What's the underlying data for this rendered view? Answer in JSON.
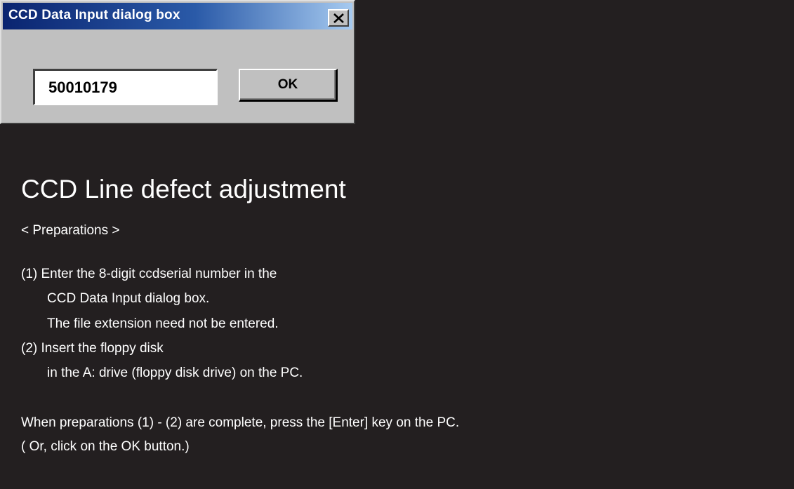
{
  "dialog": {
    "title": "CCD Data Input dialog box",
    "close_icon": "close-icon",
    "serial_value": "50010179",
    "ok_label": "OK"
  },
  "instructions": {
    "heading": "CCD Line defect adjustment",
    "preparations_label": "< Preparations >",
    "step1_line1": "(1) Enter the 8-digit ccdserial number in the",
    "step1_line2": "CCD Data Input dialog box.",
    "step1_line3": "The file extension need not be entered.",
    "step2_line1": "(2) Insert the floppy disk",
    "step2_line2": "in the A: drive (floppy disk drive) on the PC.",
    "completion_line1": "When preparations (1) - (2) are complete, press the [Enter] key on the PC.",
    "completion_line2": "( Or, click on the OK button.)"
  },
  "colors": {
    "background": "#231f20",
    "dialog_face": "#c0c0c0",
    "titlebar_start": "#0a2470",
    "titlebar_end": "#a6caf0",
    "text": "#ffffff"
  }
}
